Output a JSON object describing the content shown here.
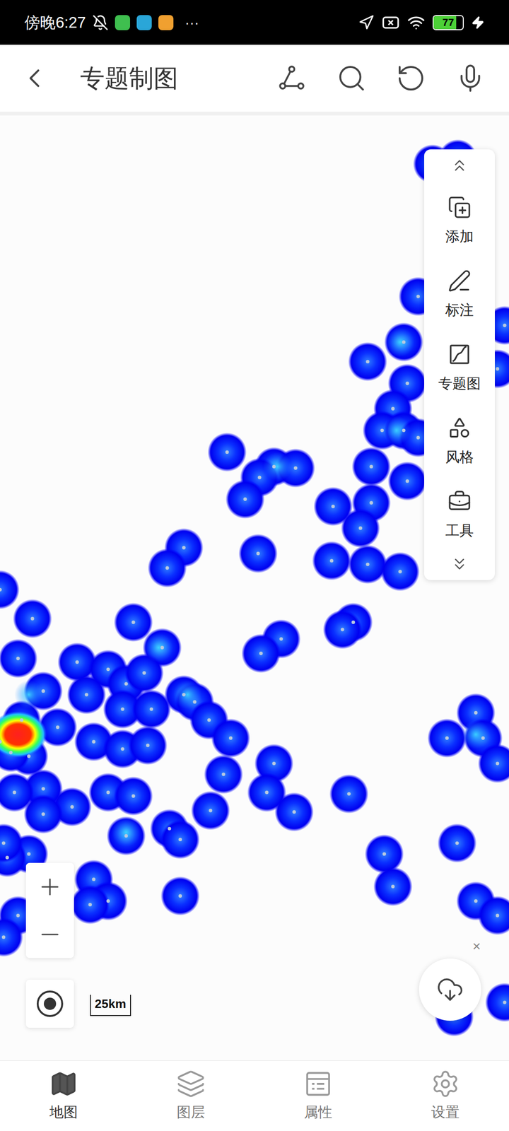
{
  "status_bar": {
    "time": "傍晚6:27",
    "more": "···",
    "battery": "77",
    "battery_level": 0.77
  },
  "header": {
    "title": "专题制图"
  },
  "toolbar": {
    "items": [
      {
        "label": "添加",
        "kind": "add"
      },
      {
        "label": "标注",
        "kind": "mark"
      },
      {
        "label": "专题图",
        "kind": "thematic"
      },
      {
        "label": "风格",
        "kind": "style"
      },
      {
        "label": "工具",
        "kind": "tools"
      }
    ]
  },
  "map": {
    "scale": "25km",
    "close": "×"
  },
  "bottom_nav": [
    {
      "label": "地图",
      "selected": true,
      "kind": "map"
    },
    {
      "label": "图层",
      "selected": false,
      "kind": "layers"
    },
    {
      "label": "属性",
      "selected": false,
      "kind": "attributes"
    },
    {
      "label": "设置",
      "selected": false,
      "kind": "settings"
    }
  ]
}
